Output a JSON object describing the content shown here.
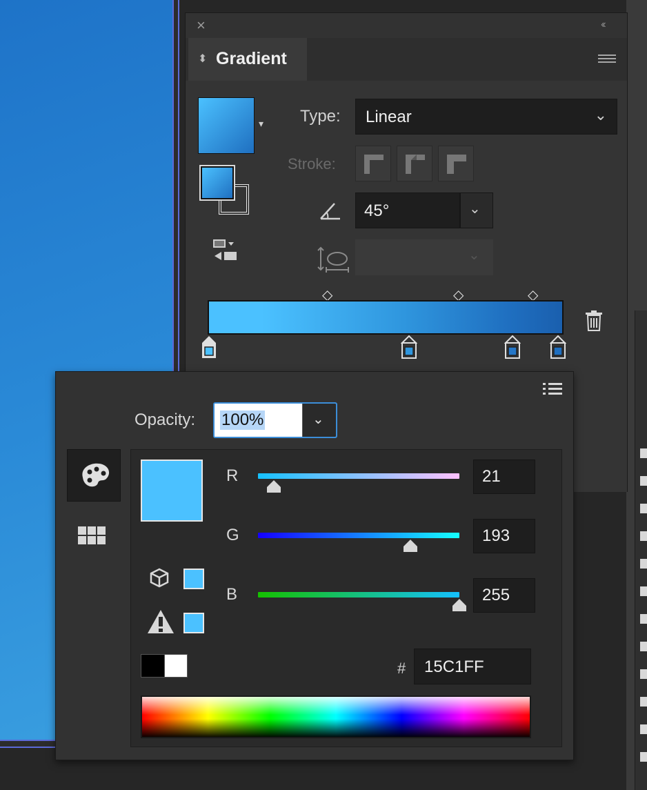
{
  "panel": {
    "close_glyph": "×",
    "collapse_glyph": "‹‹",
    "tab_label": "Gradient",
    "tab_arrow": "⬍"
  },
  "gradient": {
    "type_label": "Type:",
    "type_value": "Linear",
    "stroke_label": "Stroke:",
    "angle_value": "45°",
    "midpoints": 3,
    "stops_count": 4
  },
  "color": {
    "opacity_label": "Opacity:",
    "opacity_value": "100%",
    "channels": [
      {
        "label": "R",
        "value": "21",
        "fraction": 0.08
      },
      {
        "label": "G",
        "value": "193",
        "fraction": 0.757
      },
      {
        "label": "B",
        "value": "255",
        "fraction": 1.0
      }
    ],
    "hex_label": "#",
    "hex_value": "15C1FF",
    "current_color": "#15c1ff"
  },
  "colors": {
    "accent": "#3c8ed9",
    "gradient_start": "#4bc1ff",
    "gradient_end": "#1f6fc0"
  },
  "icons": [
    "close-icon",
    "collapse-icon",
    "panel-menu-icon",
    "reverse-gradient-icon",
    "angle-icon",
    "aspect-ratio-icon",
    "trash-icon",
    "palette-icon",
    "swatches-icon",
    "gamut-cube-icon",
    "warning-icon"
  ]
}
